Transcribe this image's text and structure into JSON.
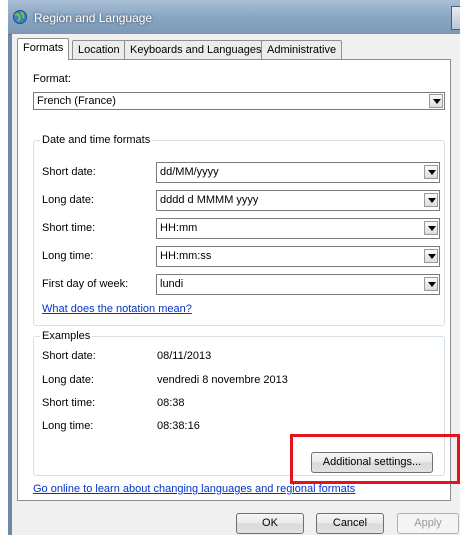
{
  "window": {
    "title": "Region and Language"
  },
  "tabs": [
    {
      "label": "Formats",
      "active": true
    },
    {
      "label": "Location",
      "active": false
    },
    {
      "label": "Keyboards and Languages",
      "active": false
    },
    {
      "label": "Administrative",
      "active": false
    }
  ],
  "format": {
    "label": "Format:",
    "value": "French (France)"
  },
  "date_time_formats": {
    "legend": "Date and time formats",
    "fields": [
      {
        "label": "Short date:",
        "value": "dd/MM/yyyy"
      },
      {
        "label": "Long date:",
        "value": "dddd d MMMM yyyy"
      },
      {
        "label": "Short time:",
        "value": "HH:mm"
      },
      {
        "label": "Long time:",
        "value": "HH:mm:ss"
      },
      {
        "label": "First day of week:",
        "value": "lundi"
      }
    ],
    "notation_link": "What does the notation mean?"
  },
  "examples": {
    "legend": "Examples",
    "rows": [
      {
        "label": "Short date:",
        "value": "08/11/2013"
      },
      {
        "label": "Long date:",
        "value": "vendredi 8 novembre 2013"
      },
      {
        "label": "Short time:",
        "value": "08:38"
      },
      {
        "label": "Long time:",
        "value": "08:38:16"
      }
    ]
  },
  "additional_settings_label": "Additional settings...",
  "online_link": "Go online to learn about changing languages and regional formats",
  "buttons": {
    "ok": "OK",
    "cancel": "Cancel",
    "apply": "Apply"
  },
  "colors": {
    "highlight": "#e3121b",
    "link": "#0033cc"
  }
}
